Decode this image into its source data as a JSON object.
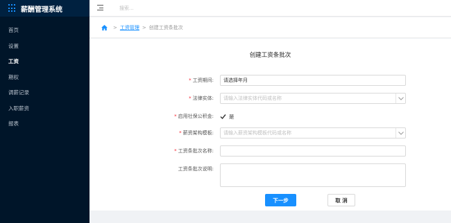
{
  "app": {
    "title": "薪酬管理系统",
    "accent_color": "#1890ff",
    "sidebar_color": "#001529"
  },
  "sidebar": {
    "items": [
      {
        "label": "首页",
        "active": false
      },
      {
        "label": "设置",
        "active": false
      },
      {
        "label": "工资",
        "active": true
      },
      {
        "label": "期权",
        "active": false
      },
      {
        "label": "调薪记录",
        "active": false
      },
      {
        "label": "入职薪资",
        "active": false
      },
      {
        "label": "报表",
        "active": false
      }
    ]
  },
  "topbar": {
    "menu_icon": "hamburger-icon",
    "search_placeholder": "搜索..."
  },
  "breadcrumb": {
    "home_icon": "home-icon",
    "sep": ">",
    "link": "工资管理",
    "current": "创建工资条批次"
  },
  "form": {
    "title": "创建工资条批次",
    "pay_period": {
      "label": "工资期间:",
      "value": "请选择年月",
      "required": true
    },
    "legal_entity": {
      "label": "法律实体:",
      "placeholder": "请输入法律实体代码或名称",
      "required": true
    },
    "social_security": {
      "label": "启用社保公积金:",
      "option": "是",
      "checked": true,
      "required": true
    },
    "salary_template": {
      "label": "薪资架构模板:",
      "placeholder": "请输入薪资架构模板代码或名称",
      "required": true
    },
    "batch_name": {
      "label": "工资条批次名称:",
      "value": "",
      "required": true
    },
    "batch_desc": {
      "label": "工资条批次说明:",
      "value": "",
      "required": false
    },
    "next_button": "下一步",
    "cancel_button": "取 消"
  }
}
